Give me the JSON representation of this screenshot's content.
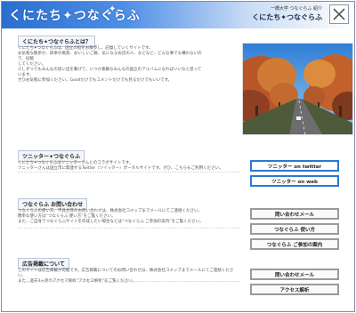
{
  "header": {
    "logo_text": "くにたち✦つなぐらふ",
    "tagline": "一橋大学 つなぐらふ 紹介",
    "title": "くにたち✦つなぐらふ"
  },
  "intro": {
    "heading": "くにたち✦つなぐらふとは？",
    "lines": [
      "くにたち✦つなぐらふは、国立の街をお散歩し、記憶していくサイトです。",
      "お気軽な散歩か、四季の風景、おいしいご飯、気になるお店の人、などなど、どんな事でも構わないので、投稿",
      "してください。",
      "少しずつでもみんなの思い出を繋げて、いつか素敵なみんなの国立のアルバムになればいいなと思っています。",
      "ぜひお気軽に参加ください。Goodだけでもコメントだけでも見るだけでもいいです。"
    ]
  },
  "twitter_section": {
    "heading": "ツニッター✦つなぐらふ",
    "lines": [
      "くにたち✦つなぐらふはツニッターさんとのコラボサイトです。",
      "ツニッターさんは国立市に関連するTwitter（ツイッター）ポータルサイトです。ぜひ、こちらもご利用ください。"
    ],
    "buttons": [
      "ツニッター on twitter",
      "ツニッター on web"
    ]
  },
  "contact_section": {
    "heading": "つなぐらふ お問い合わせ",
    "lines": [
      "つなぐらふの使い方、不具合等のお問い合わせは、株式会社コメップまでメールにてご連絡ください。",
      "簡単な使い方は“つなぐらふ 使い方”をご覧ください。",
      "また、ご自身でつなぐらふサイトを作成したい場合などは“つなぐらふ ご参加の案内”をご覧ください。"
    ],
    "buttons": [
      "問い合わせメール",
      "つなぐらふ 使い方",
      "つなぐらふ ご参加の案内"
    ]
  },
  "ads_section": {
    "heading": "広告掲載について",
    "lines": [
      "このサイトは広告掲載が可能です。広告掲載についてのお問い合わせは、株式会社コメップまでメールにてご連絡ください。",
      "また、過去3ヶ月のアクセス解析“アクセス解析”をご覧ください。"
    ],
    "buttons": [
      "問い合わせメール",
      "アクセス解析"
    ]
  },
  "colors": {
    "accent_blue": "#2a78d6",
    "header_blue": "#2a6fd0",
    "button_gray": "#9a9a9a"
  }
}
